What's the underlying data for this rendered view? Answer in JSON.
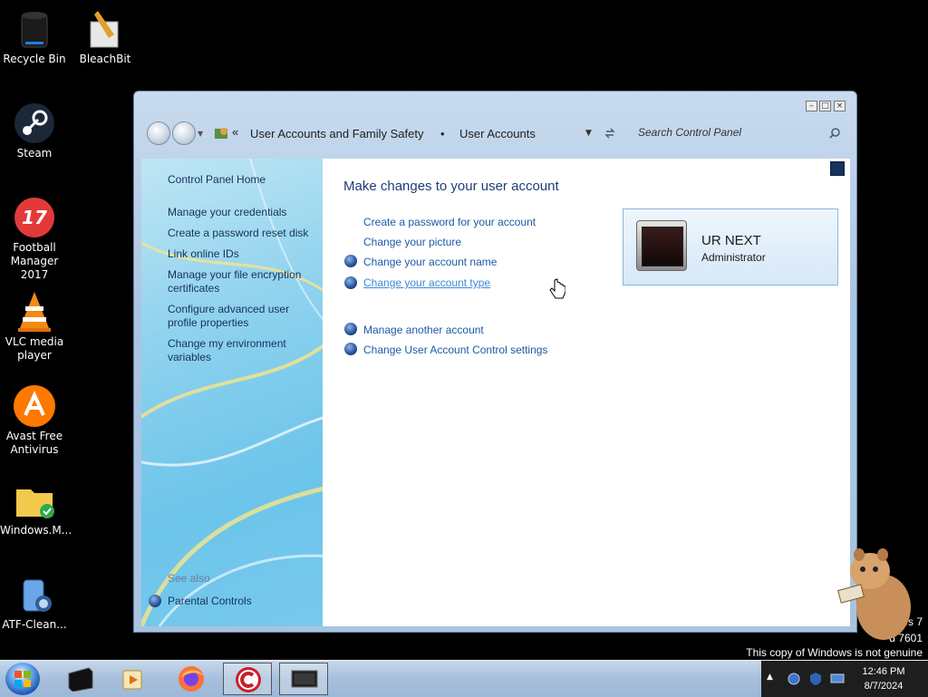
{
  "desktop": {
    "icons": [
      {
        "label": "Recycle Bin",
        "icon": "recycle-bin-icon"
      },
      {
        "label": "BleachBit",
        "icon": "bleachbit-icon"
      },
      {
        "label": "Steam",
        "icon": "steam-icon"
      },
      {
        "label": "Football Manager 2017",
        "icon": "football-manager-icon"
      },
      {
        "label": "VLC media player",
        "icon": "vlc-icon"
      },
      {
        "label": "Avast Free Antivirus",
        "icon": "avast-icon"
      },
      {
        "label": "Windows.M...",
        "icon": "folder-icon"
      },
      {
        "label": "ATF-Clean...",
        "icon": "atf-cleaner-icon"
      }
    ],
    "watermark": {
      "line1": "ws 7",
      "line2": "d 7601",
      "line3": "This copy of Windows is not genuine"
    }
  },
  "window": {
    "breadcrumb": {
      "chevron": "«",
      "item1": "User Accounts and Family Safety",
      "separator": "•",
      "item2": "User Accounts"
    },
    "search": {
      "placeholder": "Search Control Panel"
    },
    "sidebar": {
      "home": "Control Panel Home",
      "links": [
        "Manage your credentials",
        "Create a password reset disk",
        "Link online IDs",
        "Manage your file encryption certificates",
        "Configure advanced user profile properties",
        "Change my environment variables"
      ],
      "see_also": "See also",
      "parental_controls": "Parental Controls"
    },
    "main": {
      "title": "Make changes to your user account",
      "tasks": [
        {
          "label": "Create a password for your account",
          "shield": false
        },
        {
          "label": "Change your picture",
          "shield": false
        },
        {
          "label": "Change your account name",
          "shield": true
        },
        {
          "label": "Change your account type",
          "shield": true,
          "hovered": true
        },
        {
          "label": "Manage another account",
          "shield": true
        },
        {
          "label": "Change User Account Control settings",
          "shield": true
        }
      ],
      "user": {
        "name": "UR NEXT",
        "role": "Administrator"
      }
    }
  },
  "taskbar": {
    "clock": {
      "time": "12:46 PM",
      "date": "8/7/2024"
    }
  },
  "colors": {
    "link": "#1e5aa8",
    "title": "#1e3d7b",
    "sidebar_link": "#15315d"
  }
}
